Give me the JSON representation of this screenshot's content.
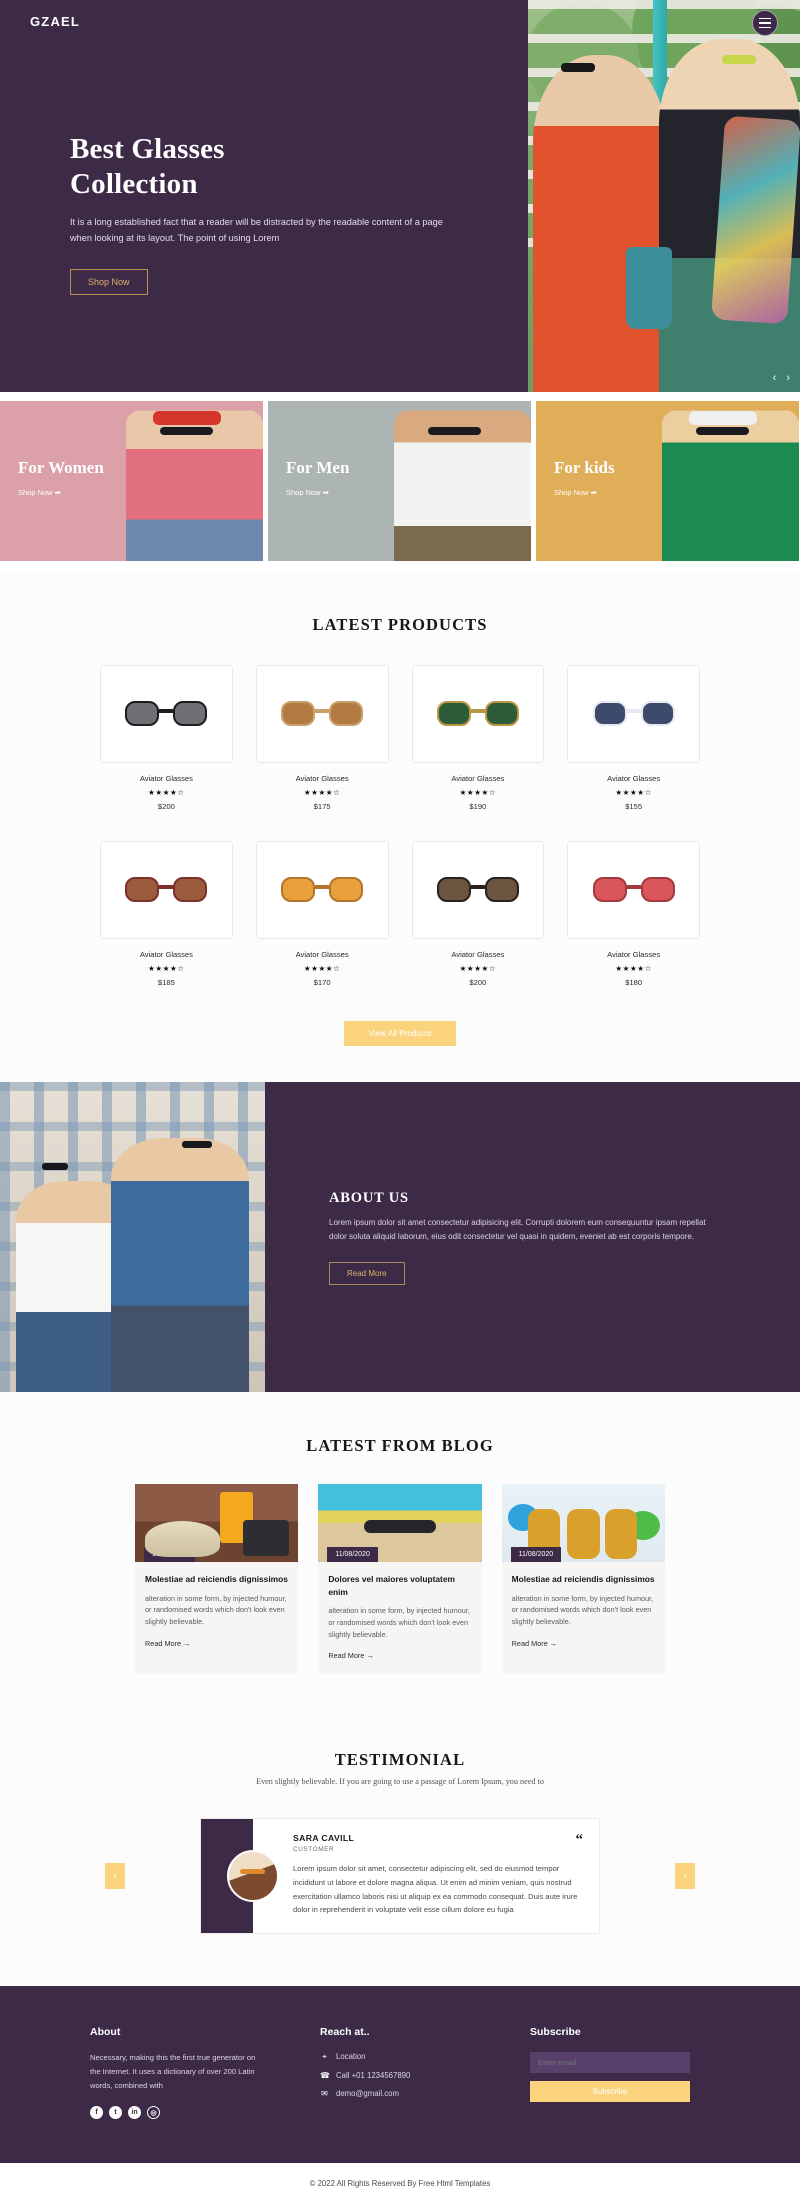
{
  "brand": {
    "logo": "GZAEL"
  },
  "hero": {
    "title_line1": "Best Glasses",
    "title_line2": "Collection",
    "subtitle": "It is a long established fact that a reader will be distracted by the readable content of a page when looking at its layout. The point of using Lorem",
    "cta": "Shop Now",
    "prev": "‹",
    "next": "›"
  },
  "categories": [
    {
      "title": "For Women",
      "link": "Shop Now ➡"
    },
    {
      "title": "For Men",
      "link": "Shop Now ➡"
    },
    {
      "title": "For kids",
      "link": "Shop Now ➡"
    }
  ],
  "products_section": {
    "heading": "LATEST PRODUCTS",
    "view_all": "View All Products",
    "items": [
      {
        "name": "Aviator Glasses",
        "stars": "★★★★☆",
        "price": "$200",
        "lens": "#6f7074",
        "frame": "#1d1d21"
      },
      {
        "name": "Aviator Glasses",
        "stars": "★★★★☆",
        "price": "$175",
        "lens": "#b07a41",
        "frame": "#caa06a"
      },
      {
        "name": "Aviator Glasses",
        "stars": "★★★★☆",
        "price": "$190",
        "lens": "#2e5c3a",
        "frame": "#b99642"
      },
      {
        "name": "Aviator Glasses",
        "stars": "★★★★☆",
        "price": "$155",
        "lens": "#3e4a6b",
        "frame": "#e6e9ef"
      },
      {
        "name": "Aviator Glasses",
        "stars": "★★★★☆",
        "price": "$185",
        "lens": "#9a5a3c",
        "frame": "#7d2f2b"
      },
      {
        "name": "Aviator Glasses",
        "stars": "★★★★☆",
        "price": "$170",
        "lens": "#e8a03a",
        "frame": "#b5742c"
      },
      {
        "name": "Aviator Glasses",
        "stars": "★★★★☆",
        "price": "$200",
        "lens": "#6b5440",
        "frame": "#2b2119"
      },
      {
        "name": "Aviator Glasses",
        "stars": "★★★★☆",
        "price": "$180",
        "lens": "#d9565c",
        "frame": "#a33a3f"
      }
    ]
  },
  "about": {
    "heading": "ABOUT US",
    "body": "Lorem ipsum dolor sit amet consectetur adipisicing elit. Corrupti dolorem eum consequuntur ipsam repellat dolor soluta aliquid laborum, eius odit consectetur vel quasi in quidem, eveniet ab est corporis tempore.",
    "cta": "Read More"
  },
  "blog": {
    "heading": "LATEST FROM BLOG",
    "posts": [
      {
        "date": "10/08/2020",
        "title": "Molestiae ad reiciendis dignissimos",
        "excerpt": "alteration in some form, by injected humour, or randomised words which don't look even slightly believable.",
        "more": "Read More →"
      },
      {
        "date": "11/08/2020",
        "title": "Dolores vel maiores voluptatem enim",
        "excerpt": "alteration in some form, by injected humour, or randomised words which don't look even slightly believable.",
        "more": "Read More →"
      },
      {
        "date": "11/08/2020",
        "title": "Molestiae ad reiciendis dignissimos",
        "excerpt": "alteration in some form, by injected humour, or randomised words which don't look even slightly believable.",
        "more": "Read More →"
      }
    ]
  },
  "testimonial": {
    "heading": "TESTIMONIAL",
    "subheading": "Even slightly believable. If you are going to use a passage of Lorem Ipsum, you need to",
    "name": "SARA CAVILL",
    "role": "CUSTOMER",
    "quote_mark": "“",
    "text": "Lorem ipsum dolor sit amet, consectetur adipiscing elit, sed do eiusmod tempor incididunt ut labore et dolore magna aliqua. Ut enim ad minim veniam, quis nostrud exercitation ullamco laboris nisi ut aliquip ex ea commodo consequat. Duis aute irure dolor in reprehenderit in voluptate velit esse cillum dolore eu fugia",
    "prev": "‹",
    "next": "›"
  },
  "footer": {
    "about_heading": "About",
    "about_text": "Necessary, making this the first true generator on the Internet. It uses a dictionary of over 200 Latin words, combined with",
    "socials": [
      "f",
      "t",
      "in",
      "◎"
    ],
    "reach_heading": "Reach at..",
    "reach_items": [
      {
        "icon": "⌖",
        "label": "Location"
      },
      {
        "icon": "☎",
        "label": "Call +01 1234567890"
      },
      {
        "icon": "✉",
        "label": "demo@gmail.com"
      }
    ],
    "subscribe_heading": "Subscribe",
    "email_placeholder": "Enter email",
    "subscribe_button": "Subscribe"
  },
  "copyright": "© 2022 All Rights Reserved By Free Html Templates",
  "colors": {
    "brand_purple": "#3c2a47",
    "accent_yellow": "#fbd37c",
    "gold": "#e0b06a"
  }
}
